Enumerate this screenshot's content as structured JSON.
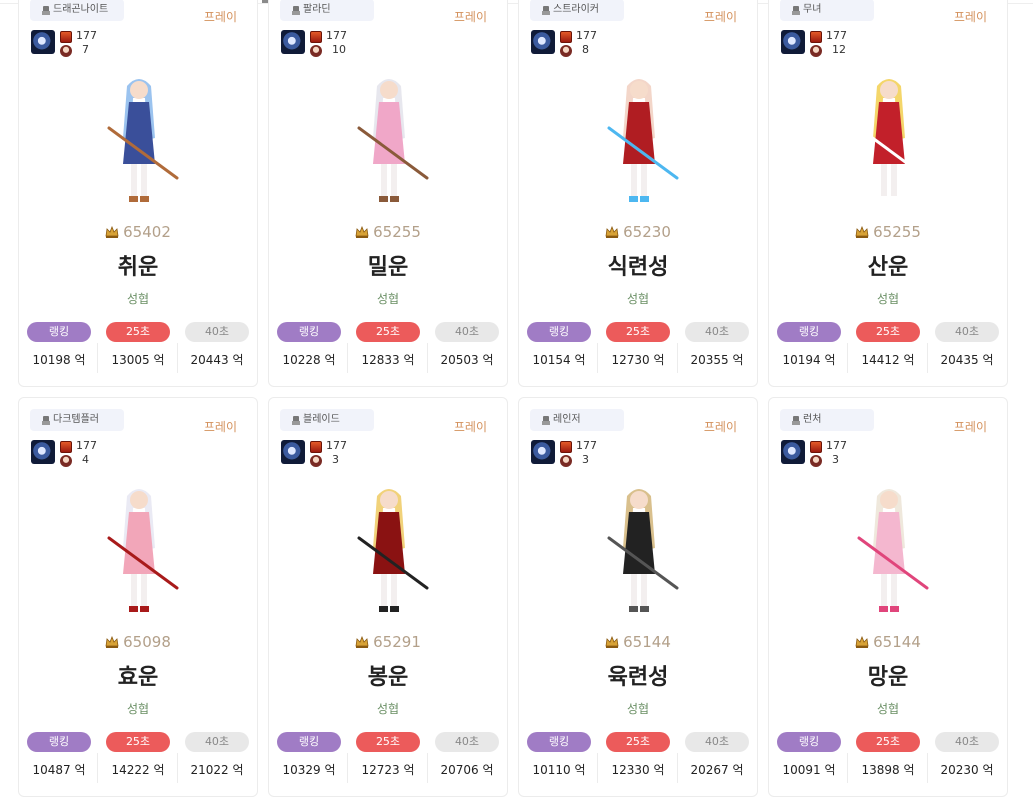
{
  "ui": {
    "unit": "억",
    "label_rank": "랭킹",
    "label_25": "25초",
    "label_40": "40초",
    "server_label": "프레이"
  },
  "colors": {
    "rank_pill": "#a07cc5",
    "pill_25": "#ec5b5b",
    "pill_40": "#e8e8e8",
    "server": "#d4915c",
    "guild": "#6a8f64",
    "score": "#b3a08a"
  },
  "cards": [
    {
      "class": "드래곤나이트",
      "level": "177",
      "buff": "7",
      "score": "65402",
      "name": "취운",
      "guild": "성협",
      "rank": "10198 억",
      "s25": "13005 억",
      "s40": "20443 억",
      "sprite": "knight-shield-rose",
      "palette": [
        "#9bc3ef",
        "#3a4f9a",
        "#b06b3a"
      ]
    },
    {
      "class": "팔라딘",
      "level": "177",
      "buff": "10",
      "score": "65255",
      "name": "밀운",
      "guild": "성협",
      "rank": "10228 억",
      "s25": "12833 억",
      "s40": "20503 억",
      "sprite": "paladin-shield-sword",
      "palette": [
        "#e7e7ee",
        "#f0a7c8",
        "#8a5a3a"
      ]
    },
    {
      "class": "스트라이커",
      "level": "177",
      "buff": "8",
      "score": "65230",
      "name": "식련성",
      "guild": "성협",
      "rank": "10154 억",
      "s25": "12730 억",
      "s40": "20355 억",
      "sprite": "striker-red-dress",
      "palette": [
        "#f3d6c9",
        "#b01d22",
        "#4db7f0"
      ]
    },
    {
      "class": "무녀",
      "level": "177",
      "buff": "12",
      "score": "65255",
      "name": "산운",
      "guild": "성협",
      "rank": "10194 억",
      "s25": "14412 억",
      "s40": "20435 억",
      "sprite": "miko-gold-staff",
      "palette": [
        "#f4d66a",
        "#c2202a",
        "#ffffff"
      ]
    },
    {
      "class": "다크템플러",
      "level": "177",
      "buff": "4",
      "score": "65098",
      "name": "효운",
      "guild": "성협",
      "rank": "10487 억",
      "s25": "14222 억",
      "s40": "21022 억",
      "sprite": "templar-pink-scythe",
      "palette": [
        "#eaeaf4",
        "#f2a6b9",
        "#a81a1a"
      ]
    },
    {
      "class": "블레이드",
      "level": "177",
      "buff": "3",
      "score": "65291",
      "name": "봉운",
      "guild": "성협",
      "rank": "10329 억",
      "s25": "12723 억",
      "s40": "20706 억",
      "sprite": "blade-red-coat",
      "palette": [
        "#f1d27a",
        "#8a1212",
        "#222222"
      ]
    },
    {
      "class": "레인저",
      "level": "177",
      "buff": "3",
      "score": "65144",
      "name": "육련성",
      "guild": "성협",
      "rank": "10110 억",
      "s25": "12330 억",
      "s40": "20267 억",
      "sprite": "ranger-black-suit",
      "palette": [
        "#d9c08d",
        "#222222",
        "#555555"
      ]
    },
    {
      "class": "런처",
      "level": "177",
      "buff": "3",
      "score": "65144",
      "name": "망운",
      "guild": "성협",
      "rank": "10091 억",
      "s25": "13898 억",
      "s40": "20230 억",
      "sprite": "launcher-pink-dress",
      "palette": [
        "#efe8dc",
        "#f4b7cf",
        "#e0457b"
      ]
    }
  ]
}
